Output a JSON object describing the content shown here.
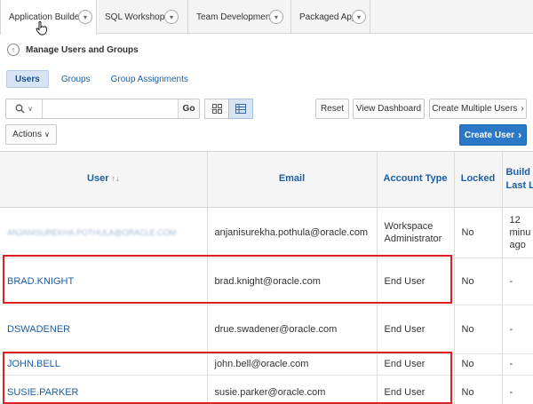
{
  "topnav": {
    "tabs": [
      {
        "label": "Application Builder",
        "active": true
      },
      {
        "label": "SQL Workshop",
        "active": false
      },
      {
        "label": "Team Development",
        "active": false
      },
      {
        "label": "Packaged Apps",
        "active": false
      }
    ]
  },
  "breadcrumb": {
    "title": "Manage Users and Groups",
    "icon": "up-arrow-icon"
  },
  "subtabs": [
    {
      "label": "Users",
      "active": true
    },
    {
      "label": "Groups",
      "active": false
    },
    {
      "label": "Group Assignments",
      "active": false
    }
  ],
  "toolbar": {
    "search_value": "",
    "go_label": "Go",
    "reset_label": "Reset",
    "view_dashboard_label": "View Dashboard",
    "create_multiple_label": "Create Multiple Users",
    "actions_label": "Actions",
    "create_user_label": "Create User"
  },
  "table": {
    "headers": {
      "user": "User",
      "email": "Email",
      "account_type": "Account Type",
      "locked": "Locked",
      "last_login": "Build Last Log"
    },
    "rows": [
      {
        "user": "ANJANISUREKHA.POTHULA@ORACLE.COM",
        "email": "anjanisurekha.pothula@oracle.com",
        "account_type": "Workspace Administrator",
        "locked": "No",
        "last_login": "12 minu ago"
      },
      {
        "user": "BRAD.KNIGHT",
        "email": "brad.knight@oracle.com",
        "account_type": "End User",
        "locked": "No",
        "last_login": "-"
      },
      {
        "user": "DSWADENER",
        "email": "drue.swadener@oracle.com",
        "account_type": "End User",
        "locked": "No",
        "last_login": "-"
      },
      {
        "user": "JOHN.BELL",
        "email": "john.bell@oracle.com",
        "account_type": "End User",
        "locked": "No",
        "last_login": "-"
      },
      {
        "user": "SUSIE.PARKER",
        "email": "susie.parker@oracle.com",
        "account_type": "End User",
        "locked": "No",
        "last_login": "-"
      }
    ]
  },
  "colors": {
    "accent": "#2a78c7",
    "link": "#1b5fa6",
    "highlight": "#e02020"
  }
}
